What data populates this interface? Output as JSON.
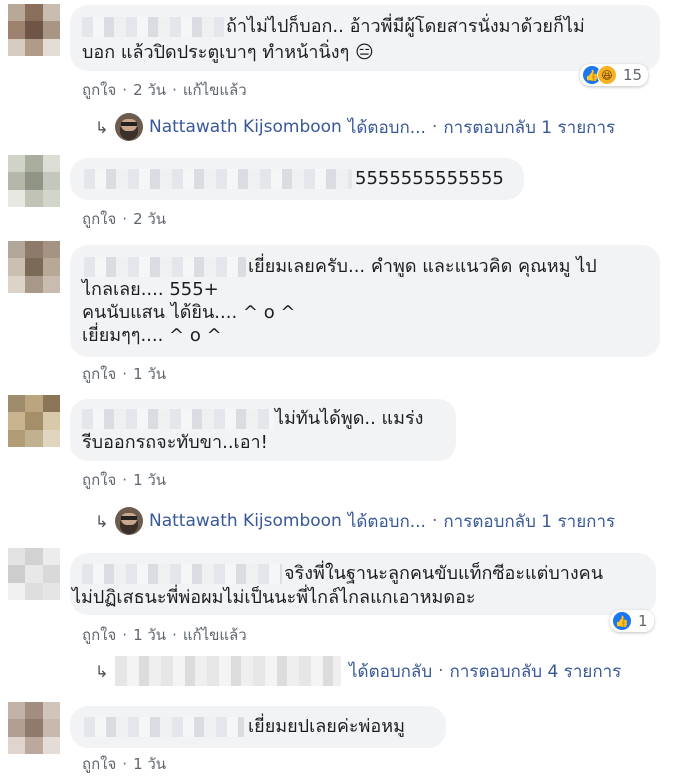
{
  "comments": [
    {
      "lines": [
        "ถ้าไม่ไปก็บอก.. อ้าวพี่มีผู้โดยสารนั่งมาด้วยก็ไม่",
        "บอก แล้วปิดประตูเบาๆ ทำหน้านิ่งๆ 😑"
      ],
      "actions": {
        "like": "ถูกใจ",
        "time": "2 วัน",
        "edited": "แก้ไขแล้ว"
      },
      "reactions": {
        "count": "15",
        "icons": [
          "like-icon",
          "haha-icon"
        ]
      },
      "reply": {
        "name": "Nattawath Kijsomboon",
        "replied": "ได้ตอบก...",
        "count_text": "การตอบกลับ 1 รายการ"
      }
    },
    {
      "lines": [
        "5555555555555"
      ],
      "actions": {
        "like": "ถูกใจ",
        "time": "2 วัน"
      }
    },
    {
      "lines": [
        "เยี่ยมเลยครับ... คำพูด และแนวคิด คุณหมู ไป",
        "ไกลเลย.... 555+",
        "คนนับแสน ได้ยิน.... ^ o ^",
        "เยี่ยมๆๆ.... ^ o ^"
      ],
      "actions": {
        "like": "ถูกใจ",
        "time": "1 วัน"
      }
    },
    {
      "lines": [
        "ไม่ทันได้พูด.. แมร่ง",
        "รีบออกรถจะทับขา..เอา!"
      ],
      "actions": {
        "like": "ถูกใจ",
        "time": "1 วัน"
      },
      "reply": {
        "name": "Nattawath Kijsomboon",
        "replied": "ได้ตอบก...",
        "count_text": "การตอบกลับ 1 รายการ"
      }
    },
    {
      "lines": [
        "จริงพี่ในฐานะลูกคนขับแท็กซีอะแต่บางคน",
        "ไม่ปฏิเสธนะพี่พ่อผมไม่เป็นนะพี่ไกล์ไกลแกเอาหมดอะ"
      ],
      "actions": {
        "like": "ถูกใจ",
        "time": "1 วัน",
        "edited": "แก้ไขแล้ว"
      },
      "reactions": {
        "count": "1",
        "icons": [
          "like-icon"
        ]
      },
      "reply": {
        "replied": "ได้ตอบกลับ",
        "count_text": "การตอบกลับ 4 รายการ"
      }
    },
    {
      "lines": [
        "เยี่ยมยปเลยค่ะพ่อหมู"
      ],
      "actions": {
        "like": "ถูกใจ",
        "time": "1 วัน"
      }
    }
  ],
  "symbols": {
    "dot": "·",
    "reply_arrow": "↳"
  },
  "colors": {
    "link": "#385898",
    "bubble": "#f2f3f5",
    "meta": "#606770",
    "like_blue": "#1877f2"
  }
}
